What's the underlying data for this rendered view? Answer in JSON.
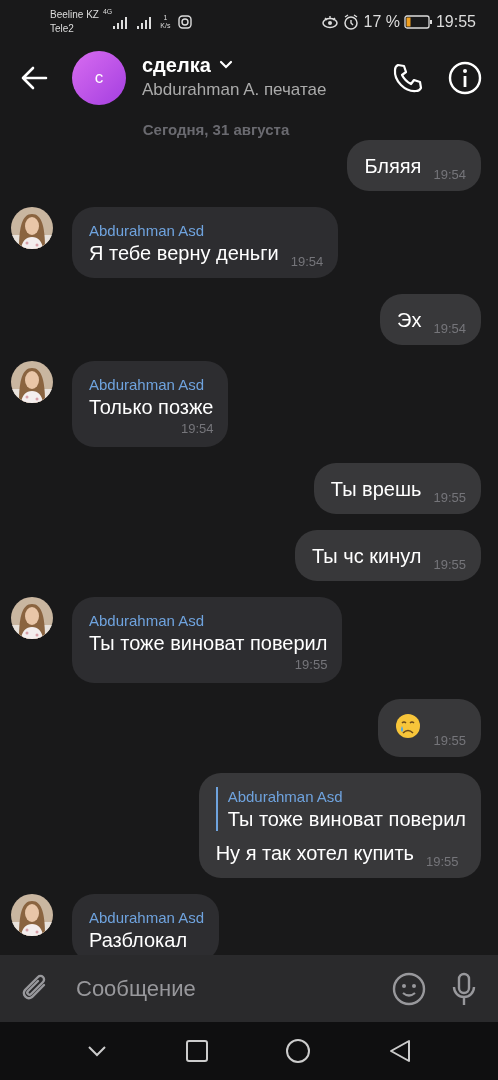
{
  "status_bar": {
    "carrier_1": "Beeline KZ",
    "carrier_2": "Tele2",
    "network": "4G",
    "speed_value": "1",
    "speed_unit": "K/s",
    "battery": "17 %",
    "time": "19:55"
  },
  "header": {
    "avatar_letter": "с",
    "title": "сделка",
    "subtitle": "Abdurahman A. печатае"
  },
  "date_separator": "Сегодня, 31 августа",
  "messages": [
    {
      "kind": "text",
      "outgoing": true,
      "text": "Бляяя",
      "time": "19:54"
    },
    {
      "kind": "text",
      "outgoing": false,
      "sender": "Abdurahman Asd",
      "text": "Я тебе верну деньги",
      "time": "19:54"
    },
    {
      "kind": "text",
      "outgoing": true,
      "text": "Эх",
      "time": "19:54"
    },
    {
      "kind": "text",
      "outgoing": false,
      "sender": "Abdurahman Asd",
      "text": "Только позже",
      "time": "19:54",
      "time_below": true
    },
    {
      "kind": "text",
      "outgoing": true,
      "text": "Ты врешь",
      "time": "19:55"
    },
    {
      "kind": "text",
      "outgoing": true,
      "text": "Ты чс кинул",
      "time": "19:55"
    },
    {
      "kind": "text",
      "outgoing": false,
      "sender": "Abdurahman Asd",
      "text": "Ты тоже виноват поверил",
      "time": "19:55",
      "time_below": true
    },
    {
      "kind": "emoji",
      "outgoing": true,
      "time": "19:55"
    },
    {
      "kind": "text",
      "outgoing": true,
      "reply": {
        "sender": "Abdurahman Asd",
        "text": "Ты тоже виноват поверил"
      },
      "text": "Ну я так хотел купить",
      "time": "19:55"
    },
    {
      "kind": "text",
      "outgoing": false,
      "sender": "Abdurahman Asd",
      "text": "Разблокал"
    }
  ],
  "composer": {
    "placeholder": "Сообщение"
  }
}
